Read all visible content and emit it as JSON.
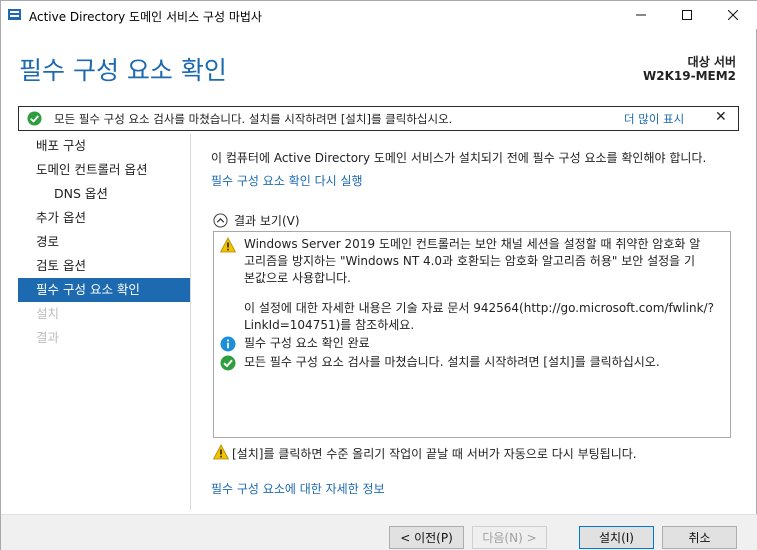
{
  "window": {
    "title": "Active Directory 도메인 서비스 구성 마법사"
  },
  "header": {
    "page_title": "필수 구성 요소 확인",
    "dest_label": "대상 서버",
    "dest_value": "W2K19-MEM2"
  },
  "notification": {
    "text": "모든 필수 구성 요소 검사를 마쳤습니다. 설치를 시작하려면 [설치]를 클릭하십시오.",
    "more_link": "더 많이 표시",
    "close": "✕"
  },
  "sidebar": {
    "items": [
      {
        "label": "배포 구성",
        "state": "normal"
      },
      {
        "label": "도메인 컨트롤러 옵션",
        "state": "normal"
      },
      {
        "label": "DNS 옵션",
        "state": "sub"
      },
      {
        "label": "추가 옵션",
        "state": "normal"
      },
      {
        "label": "경로",
        "state": "normal"
      },
      {
        "label": "검토 옵션",
        "state": "normal"
      },
      {
        "label": "필수 구성 요소 확인",
        "state": "active"
      },
      {
        "label": "설치",
        "state": "disabled"
      },
      {
        "label": "결과",
        "state": "disabled"
      }
    ]
  },
  "main": {
    "intro": "이 컴퓨터에 Active Directory 도메인 서비스가 설치되기 전에 필수 구성 요소를 확인해야 합니다.",
    "rerun_link": "필수 구성 요소 확인 다시 실행",
    "results_toggle": "결과 보기(V)",
    "results": {
      "warning_lines": [
        "Windows Server 2019 도메인 컨트롤러는 보안 채널 세션을 설정할 때 취약한 암호화 알",
        "고리즘을 방지하는 \"Windows NT 4.0과 호환되는 암호화 알고리즘 허용\" 보안 설정을 기",
        "본값으로 사용합니다."
      ],
      "detail_lines": [
        "이 설정에 대한 자세한 내용은 기술 자료 문서 942564(http://go.microsoft.com/fwlink/?",
        "LinkId=104751)를 참조하세요."
      ],
      "info_line": "필수 구성 요소 확인 완료",
      "success_line": "모든 필수 구성 요소 검사를 마쳤습니다. 설치를 시작하려면 [설치]를 클릭하십시오."
    },
    "reboot_note": "[설치]를 클릭하면 수준 올리기 작업이 끝날 때 서버가 자동으로 다시 부팅됩니다.",
    "more_info_link": "필수 구성 요소에 대한 자세한 정보"
  },
  "footer": {
    "prev": "< 이전(P)",
    "next": "다음(N) >",
    "install": "설치(I)",
    "cancel": "취소"
  },
  "colors": {
    "accent": "#1d6ab1",
    "success": "#2f9e3f",
    "warning": "#f2c200",
    "info": "#1d8fd6"
  }
}
